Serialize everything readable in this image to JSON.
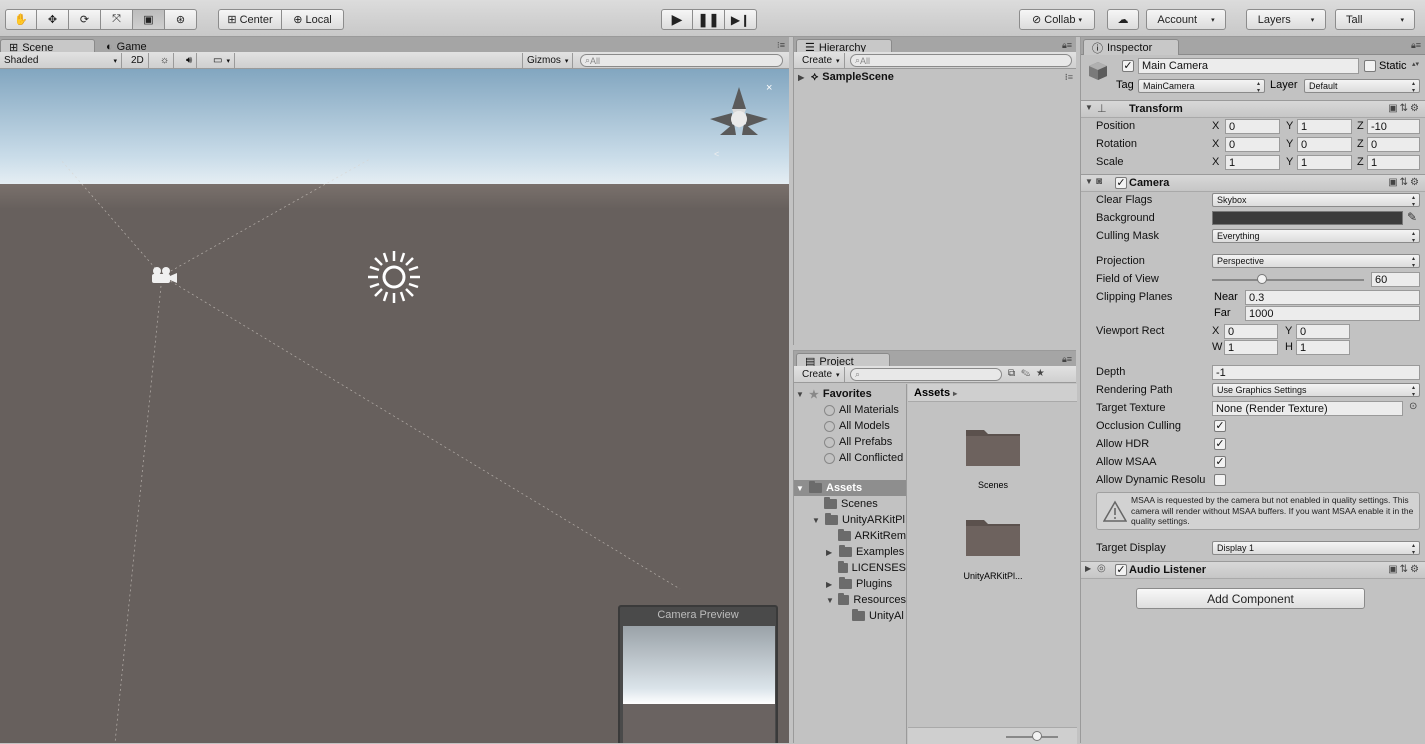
{
  "toolbar": {
    "tools": [
      "hand-tool-icon",
      "move-tool-icon",
      "rotate-tool-icon",
      "scale-tool-icon",
      "rect-tool-icon",
      "transform-tool-icon"
    ],
    "pivot_label": "Center",
    "space_label": "Local",
    "play_icons": [
      "play-icon",
      "pause-icon",
      "step-icon"
    ],
    "collab_label": "Collab",
    "account_label": "Account",
    "layers_label": "Layers",
    "layout_label": "Tall"
  },
  "scene": {
    "tabs": [
      "Scene",
      "Game"
    ],
    "shading": "Shaded",
    "mode2d": "2D",
    "gizmos": "Gizmos",
    "search_placeholder": "All",
    "preview_title": "Camera Preview"
  },
  "hierarchy": {
    "tab": "Hierarchy",
    "create": "Create",
    "search_placeholder": "All",
    "scene_name": "SampleScene"
  },
  "project": {
    "tab": "Project",
    "create": "Create",
    "favorites_label": "Favorites",
    "favorites": [
      "All Materials",
      "All Models",
      "All Prefabs",
      "All Conflicted"
    ],
    "assets_root": "Assets",
    "tree": [
      "Scenes",
      "UnityARKitPl",
      "ARKitRem",
      "Examples",
      "LICENSES",
      "Plugins",
      "Resources",
      "UnityAl"
    ],
    "breadcrumb": "Assets",
    "grid": [
      "Scenes",
      "UnityARKitPl..."
    ]
  },
  "inspector": {
    "tab": "Inspector",
    "object_name": "Main Camera",
    "static_label": "Static",
    "tag_label": "Tag",
    "tag_value": "MainCamera",
    "layer_label": "Layer",
    "layer_value": "Default",
    "transform": {
      "title": "Transform",
      "position_label": "Position",
      "rotation_label": "Rotation",
      "scale_label": "Scale",
      "position": [
        "0",
        "1",
        "-10"
      ],
      "rotation": [
        "0",
        "0",
        "0"
      ],
      "scale": [
        "1",
        "1",
        "1"
      ]
    },
    "camera": {
      "title": "Camera",
      "clear_flags_label": "Clear Flags",
      "clear_flags": "Skybox",
      "background_label": "Background",
      "background_color": "#3b3b3b",
      "culling_mask_label": "Culling Mask",
      "culling_mask": "Everything",
      "projection_label": "Projection",
      "projection": "Perspective",
      "fov_label": "Field of View",
      "fov": "60",
      "fov_fraction": 0.33,
      "clipping_label": "Clipping Planes",
      "near_label": "Near",
      "near": "0.3",
      "far_label": "Far",
      "far": "1000",
      "viewport_label": "Viewport Rect",
      "vp_x": "0",
      "vp_y": "0",
      "vp_w": "1",
      "vp_h": "1",
      "depth_label": "Depth",
      "depth": "-1",
      "rendering_path_label": "Rendering Path",
      "rendering_path": "Use Graphics Settings",
      "target_texture_label": "Target Texture",
      "target_texture": "None (Render Texture)",
      "occlusion_label": "Occlusion Culling",
      "hdr_label": "Allow HDR",
      "msaa_label": "Allow MSAA",
      "dynres_label": "Allow Dynamic Resolu",
      "warning": "MSAA is requested by the camera but not enabled in quality settings. This camera will render without MSAA buffers. If you want MSAA enable it in the quality settings.",
      "target_display_label": "Target Display",
      "target_display": "Display 1"
    },
    "audio_listener": "Audio Listener",
    "add_component": "Add Component"
  }
}
